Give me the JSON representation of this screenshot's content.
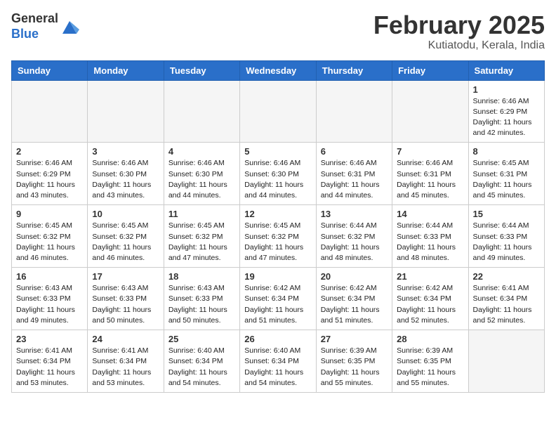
{
  "header": {
    "logo_general": "General",
    "logo_blue": "Blue",
    "month_title": "February 2025",
    "location": "Kutiatodu, Kerala, India"
  },
  "weekdays": [
    "Sunday",
    "Monday",
    "Tuesday",
    "Wednesday",
    "Thursday",
    "Friday",
    "Saturday"
  ],
  "weeks": [
    [
      {
        "day": "",
        "info": ""
      },
      {
        "day": "",
        "info": ""
      },
      {
        "day": "",
        "info": ""
      },
      {
        "day": "",
        "info": ""
      },
      {
        "day": "",
        "info": ""
      },
      {
        "day": "",
        "info": ""
      },
      {
        "day": "1",
        "info": "Sunrise: 6:46 AM\nSunset: 6:29 PM\nDaylight: 11 hours\nand 42 minutes."
      }
    ],
    [
      {
        "day": "2",
        "info": "Sunrise: 6:46 AM\nSunset: 6:29 PM\nDaylight: 11 hours\nand 43 minutes."
      },
      {
        "day": "3",
        "info": "Sunrise: 6:46 AM\nSunset: 6:30 PM\nDaylight: 11 hours\nand 43 minutes."
      },
      {
        "day": "4",
        "info": "Sunrise: 6:46 AM\nSunset: 6:30 PM\nDaylight: 11 hours\nand 44 minutes."
      },
      {
        "day": "5",
        "info": "Sunrise: 6:46 AM\nSunset: 6:30 PM\nDaylight: 11 hours\nand 44 minutes."
      },
      {
        "day": "6",
        "info": "Sunrise: 6:46 AM\nSunset: 6:31 PM\nDaylight: 11 hours\nand 44 minutes."
      },
      {
        "day": "7",
        "info": "Sunrise: 6:46 AM\nSunset: 6:31 PM\nDaylight: 11 hours\nand 45 minutes."
      },
      {
        "day": "8",
        "info": "Sunrise: 6:45 AM\nSunset: 6:31 PM\nDaylight: 11 hours\nand 45 minutes."
      }
    ],
    [
      {
        "day": "9",
        "info": "Sunrise: 6:45 AM\nSunset: 6:32 PM\nDaylight: 11 hours\nand 46 minutes."
      },
      {
        "day": "10",
        "info": "Sunrise: 6:45 AM\nSunset: 6:32 PM\nDaylight: 11 hours\nand 46 minutes."
      },
      {
        "day": "11",
        "info": "Sunrise: 6:45 AM\nSunset: 6:32 PM\nDaylight: 11 hours\nand 47 minutes."
      },
      {
        "day": "12",
        "info": "Sunrise: 6:45 AM\nSunset: 6:32 PM\nDaylight: 11 hours\nand 47 minutes."
      },
      {
        "day": "13",
        "info": "Sunrise: 6:44 AM\nSunset: 6:32 PM\nDaylight: 11 hours\nand 48 minutes."
      },
      {
        "day": "14",
        "info": "Sunrise: 6:44 AM\nSunset: 6:33 PM\nDaylight: 11 hours\nand 48 minutes."
      },
      {
        "day": "15",
        "info": "Sunrise: 6:44 AM\nSunset: 6:33 PM\nDaylight: 11 hours\nand 49 minutes."
      }
    ],
    [
      {
        "day": "16",
        "info": "Sunrise: 6:43 AM\nSunset: 6:33 PM\nDaylight: 11 hours\nand 49 minutes."
      },
      {
        "day": "17",
        "info": "Sunrise: 6:43 AM\nSunset: 6:33 PM\nDaylight: 11 hours\nand 50 minutes."
      },
      {
        "day": "18",
        "info": "Sunrise: 6:43 AM\nSunset: 6:33 PM\nDaylight: 11 hours\nand 50 minutes."
      },
      {
        "day": "19",
        "info": "Sunrise: 6:42 AM\nSunset: 6:34 PM\nDaylight: 11 hours\nand 51 minutes."
      },
      {
        "day": "20",
        "info": "Sunrise: 6:42 AM\nSunset: 6:34 PM\nDaylight: 11 hours\nand 51 minutes."
      },
      {
        "day": "21",
        "info": "Sunrise: 6:42 AM\nSunset: 6:34 PM\nDaylight: 11 hours\nand 52 minutes."
      },
      {
        "day": "22",
        "info": "Sunrise: 6:41 AM\nSunset: 6:34 PM\nDaylight: 11 hours\nand 52 minutes."
      }
    ],
    [
      {
        "day": "23",
        "info": "Sunrise: 6:41 AM\nSunset: 6:34 PM\nDaylight: 11 hours\nand 53 minutes."
      },
      {
        "day": "24",
        "info": "Sunrise: 6:41 AM\nSunset: 6:34 PM\nDaylight: 11 hours\nand 53 minutes."
      },
      {
        "day": "25",
        "info": "Sunrise: 6:40 AM\nSunset: 6:34 PM\nDaylight: 11 hours\nand 54 minutes."
      },
      {
        "day": "26",
        "info": "Sunrise: 6:40 AM\nSunset: 6:34 PM\nDaylight: 11 hours\nand 54 minutes."
      },
      {
        "day": "27",
        "info": "Sunrise: 6:39 AM\nSunset: 6:35 PM\nDaylight: 11 hours\nand 55 minutes."
      },
      {
        "day": "28",
        "info": "Sunrise: 6:39 AM\nSunset: 6:35 PM\nDaylight: 11 hours\nand 55 minutes."
      },
      {
        "day": "",
        "info": ""
      }
    ]
  ]
}
